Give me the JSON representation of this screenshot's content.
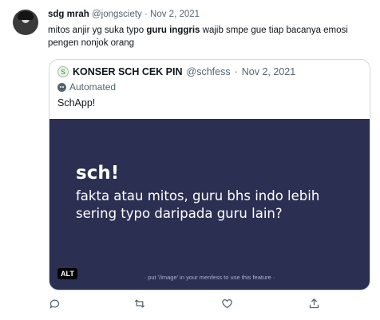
{
  "tweet": {
    "author": {
      "name": "sdg mrah",
      "handle": "@jongsciety",
      "separator": "·",
      "date": "Nov 2, 2021"
    },
    "text": {
      "part1": "mitos anjir yg suka typo ",
      "bold": "guru inggris",
      "part2": " wajib smpe gue tiap bacanya emosi pengen nonjok orang"
    },
    "quote": {
      "avatar_glyph": "S",
      "name": "KONSER SCH CEK PIN",
      "handle": "@schfess",
      "separator": "·",
      "date": "Nov 2, 2021",
      "label": "Automated",
      "text": "SchApp!",
      "media": {
        "brand": "sch!",
        "line1": "fakta atau mitos, guru bhs indo lebih",
        "line2": "sering typo daripada guru lain?",
        "footer": "· put '/image' in your menfess to use this feature ·",
        "alt_badge": "ALT",
        "background": "#2b2f52"
      }
    },
    "actions": [
      {
        "name": "reply-icon"
      },
      {
        "name": "retweet-icon"
      },
      {
        "name": "like-icon"
      },
      {
        "name": "share-icon"
      }
    ]
  }
}
